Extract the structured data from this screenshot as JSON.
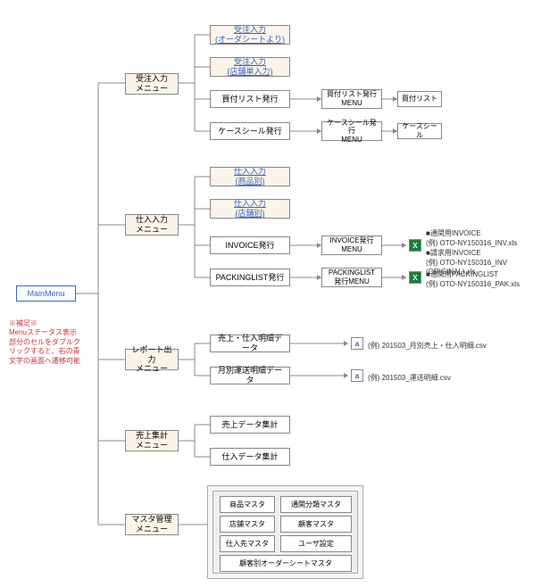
{
  "root": "MainMenu",
  "note": "※補足※\nMenuステータス表示部分のセルをダブルクリックすると、右の青文字の画面へ遷移可能",
  "m1": {
    "label": "受注入力\nメニュー",
    "i1": "受注入力\n(オーダシートより)",
    "i2": "受注入力\n(店舗単入力)",
    "i3": "買付リスト発行",
    "i4": "ケースシール発行",
    "s3": "買付リスト発行\nMENU",
    "s3b": "買付リスト",
    "s4": "ケースシール発行\nMENU",
    "s4b": "ケースシール"
  },
  "m2": {
    "label": "仕入入力\nメニュー",
    "i1": "仕入入力\n(商品別)",
    "i2": "仕入入力\n(店舗別)",
    "i3": "INVOICE発行",
    "i4": "PACKINGLIST発行",
    "s3": "INVOICE発行\nMENU",
    "s4": "PACKINGLIST\n発行MENU",
    "t1": "■通関用INVOICE\n  (例) OTO-NY150316_INV.xls\n■請求用INVOICE\n  (例) OTO-NY150316_INV (ORIGINAL).xls",
    "t2": "■通関用PACKINGLIST\n  (例) OTO-NY150316_PAK.xls"
  },
  "m3": {
    "label": "レポート出力\nメニュー",
    "i1": "売上・仕入明細データ",
    "i2": "月別運送明細データ",
    "t1": "(例)  201503_月別売上・仕入明細.csv",
    "t2": "(例)  201503_運送明細.csv"
  },
  "m4": {
    "label": "売上集計\nメニュー",
    "i1": "売上データ集計",
    "i2": "仕入データ集計"
  },
  "m5": {
    "label": "マスタ管理\nメニュー",
    "c1": "商品マスタ",
    "c2": "通関分類マスタ",
    "c3": "店舗マスタ",
    "c4": "顧客マスタ",
    "c5": "仕入先マスタ",
    "c6": "ユーザ設定",
    "c7": "顧客別オーダーシートマスタ"
  }
}
